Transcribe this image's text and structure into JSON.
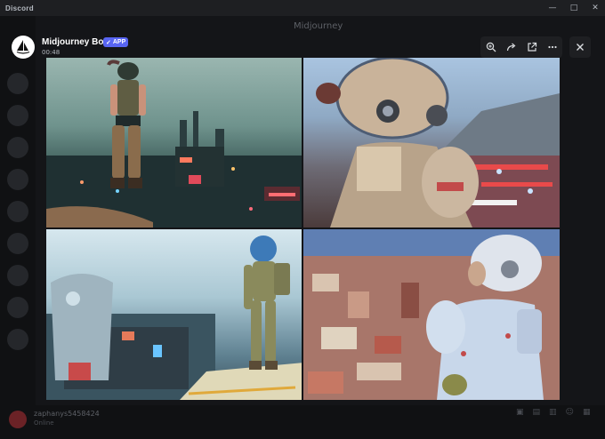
{
  "window": {
    "app_title": "Discord",
    "controls": [
      "minimize-icon",
      "maximize-icon",
      "close-icon"
    ]
  },
  "background": {
    "channel_name": "Midjourney",
    "user": {
      "name": "zaphanys5458424",
      "status": "Online"
    }
  },
  "viewer": {
    "author": "Midjourney Bot",
    "badge": "APP",
    "badge_check": "✓",
    "timestamp": "00:48",
    "toolbar": [
      {
        "name": "zoom-icon",
        "glyph": "⊕"
      },
      {
        "name": "forward-icon",
        "glyph": "↪"
      },
      {
        "name": "open-external-icon",
        "glyph": "⧉"
      },
      {
        "name": "more-icon",
        "glyph": "⋯"
      }
    ],
    "close_glyph": "✕"
  },
  "colors": {
    "accent": "#5865f2",
    "chrome": "#1e1f22",
    "backdrop": "#0b0c0e"
  }
}
